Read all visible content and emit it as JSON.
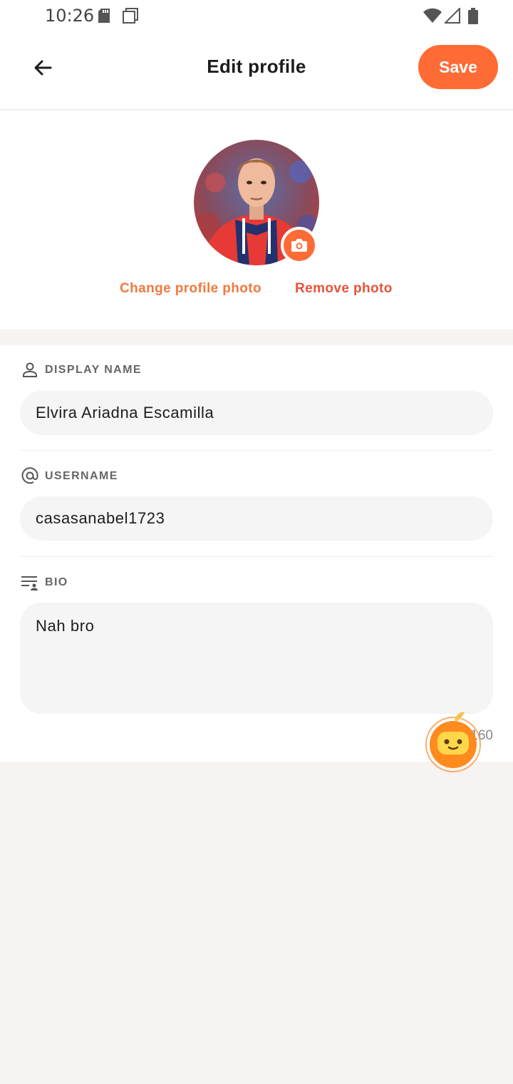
{
  "status_bar": {
    "time": "10:26",
    "icons": [
      "sd-card-icon",
      "screenshot-icon",
      "wifi-icon",
      "signal-icon",
      "battery-icon"
    ]
  },
  "header": {
    "back_icon": "arrow-left-icon",
    "title": "Edit profile",
    "save_label": "Save"
  },
  "profile_photo": {
    "change_label": "Change profile photo",
    "remove_label": "Remove photo",
    "camera_icon": "camera-icon"
  },
  "form": {
    "display_name": {
      "label": "DISPLAY NAME",
      "icon": "person-icon",
      "value": "Elvira Ariadna Escamilla"
    },
    "username": {
      "label": "USERNAME",
      "icon": "at-sign-icon",
      "value": "casasanabel1723"
    },
    "bio": {
      "label": "BIO",
      "icon": "bio-lines-icon",
      "value": "Nah bro",
      "char_count": "160"
    }
  },
  "assistant": {
    "icon": "robot-assistant-icon"
  },
  "colors": {
    "accent": "#ff6b35",
    "remove": "#e8533a",
    "field_bg": "#f5f5f5",
    "page_bg": "#f6f3f0"
  }
}
